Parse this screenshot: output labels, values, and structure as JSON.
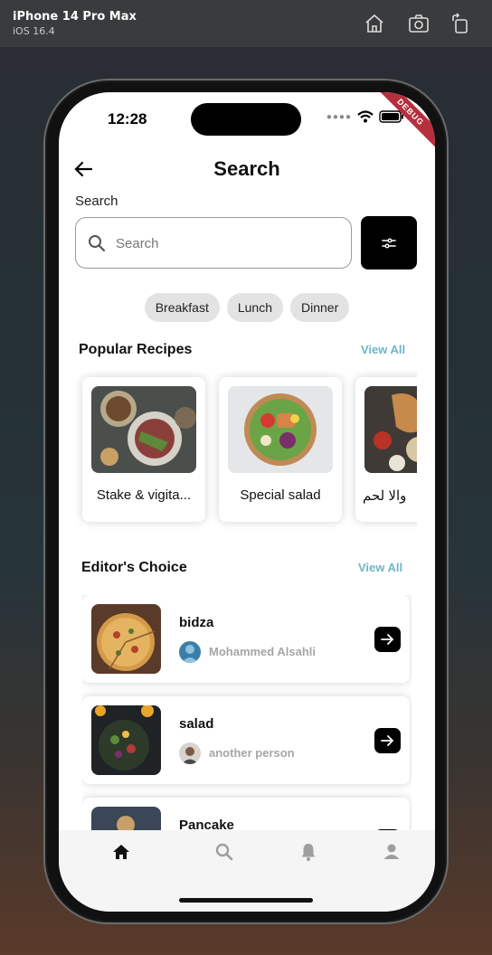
{
  "simulator": {
    "device": "iPhone 14 Pro Max",
    "os": "iOS 16.4",
    "icons": [
      "home-icon",
      "screenshot-icon",
      "rotate-icon"
    ]
  },
  "status_bar": {
    "time": "12:28",
    "debug_label": "DEBUG"
  },
  "header": {
    "title": "Search",
    "back_icon": "arrow-left-icon"
  },
  "search": {
    "label": "Search",
    "placeholder": "Search",
    "value": "",
    "filter_icon": "filter-icon"
  },
  "chips": [
    "Breakfast",
    "Lunch",
    "Dinner"
  ],
  "popular": {
    "title": "Popular Recipes",
    "view_all": "View All",
    "items": [
      {
        "name": "Stake & vigita..."
      },
      {
        "name": "Special salad"
      },
      {
        "name": "والا لحم"
      }
    ]
  },
  "editors_choice": {
    "title": "Editor's Choice",
    "view_all": "View All",
    "items": [
      {
        "name": "bidza",
        "author": "Mohammed Alsahli"
      },
      {
        "name": "salad",
        "author": "another person"
      },
      {
        "name": "Pancake",
        "author": ""
      }
    ]
  },
  "bottom_nav": {
    "items": [
      "home-icon",
      "search-icon",
      "bell-icon",
      "person-icon"
    ],
    "active": "home-icon",
    "active_color": "#111111",
    "inactive_color": "#9e9e9e"
  },
  "colors": {
    "accent": "#6fb5c8",
    "chip_bg": "#e3e3e3",
    "debug_ribbon": "#b5303c"
  }
}
